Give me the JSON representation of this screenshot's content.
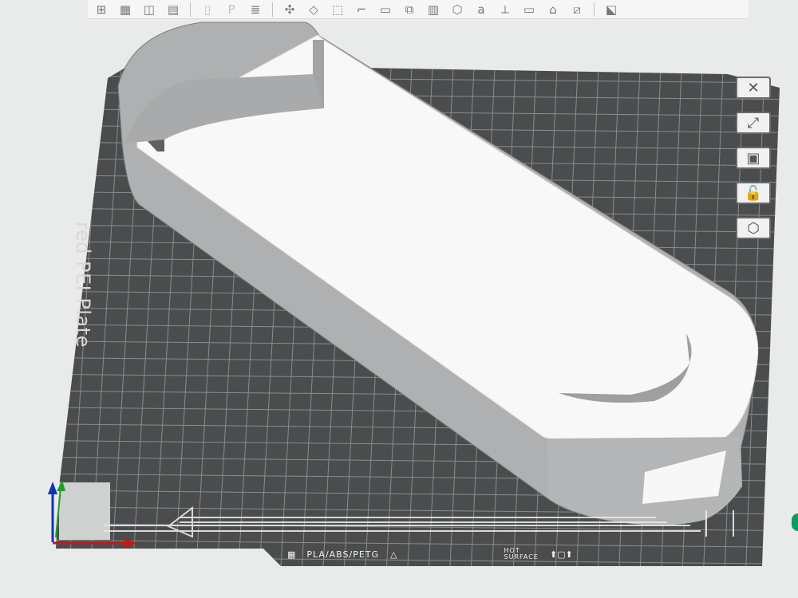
{
  "toolbar": {
    "items": [
      {
        "icon": "add-object-icon",
        "glyph": "⊞"
      },
      {
        "icon": "add-plate-icon",
        "glyph": "▦"
      },
      {
        "icon": "orient-icon",
        "glyph": "◫"
      },
      {
        "icon": "arrange-icon",
        "glyph": "▤"
      },
      {
        "icon": "cut-disabled-icon",
        "glyph": "▯"
      },
      {
        "icon": "paint-disabled-icon",
        "glyph": "P"
      },
      {
        "icon": "layers-icon",
        "glyph": "≣"
      },
      {
        "icon": "move-icon",
        "glyph": "✣"
      },
      {
        "icon": "rotate-icon",
        "glyph": "◇"
      },
      {
        "icon": "scale-icon",
        "glyph": "⬚"
      },
      {
        "icon": "lay-flat-icon",
        "glyph": "⌐"
      },
      {
        "icon": "cut-icon",
        "glyph": "▭"
      },
      {
        "icon": "boolean-icon",
        "glyph": "⧉"
      },
      {
        "icon": "support-paint-icon",
        "glyph": "▥"
      },
      {
        "icon": "seam-paint-icon",
        "glyph": "⬡"
      },
      {
        "icon": "text-icon",
        "glyph": "a"
      },
      {
        "icon": "measure-icon",
        "glyph": "⟂"
      },
      {
        "icon": "assembly-icon",
        "glyph": "▭"
      },
      {
        "icon": "variable-layer-icon",
        "glyph": "⌂"
      },
      {
        "icon": "split-icon",
        "glyph": "⧄"
      },
      {
        "icon": "view-icon",
        "glyph": "⬕"
      }
    ]
  },
  "plate": {
    "label": "red PEI Plate",
    "material": "PLA/ABS/PETG",
    "warning_line1": "HOT",
    "warning_line2": "SURFACE"
  },
  "right_tools": [
    {
      "name": "close-icon",
      "glyph": "✕"
    },
    {
      "name": "auto-arrange-icon",
      "glyph": "⤢"
    },
    {
      "name": "layout-icon",
      "glyph": "▣"
    },
    {
      "name": "lock-icon",
      "glyph": "🔓"
    },
    {
      "name": "settings-hex-icon",
      "glyph": "⬡"
    }
  ],
  "colors": {
    "background": "#e9eaea",
    "plate": "#4a4c4d",
    "grid": "#8c8e90",
    "model": "#f8f8f8",
    "model_shadow": "#a7a7a7",
    "x_axis": "#c11a1a",
    "y_axis": "#1f9f2b",
    "z_axis": "#1033b8"
  }
}
